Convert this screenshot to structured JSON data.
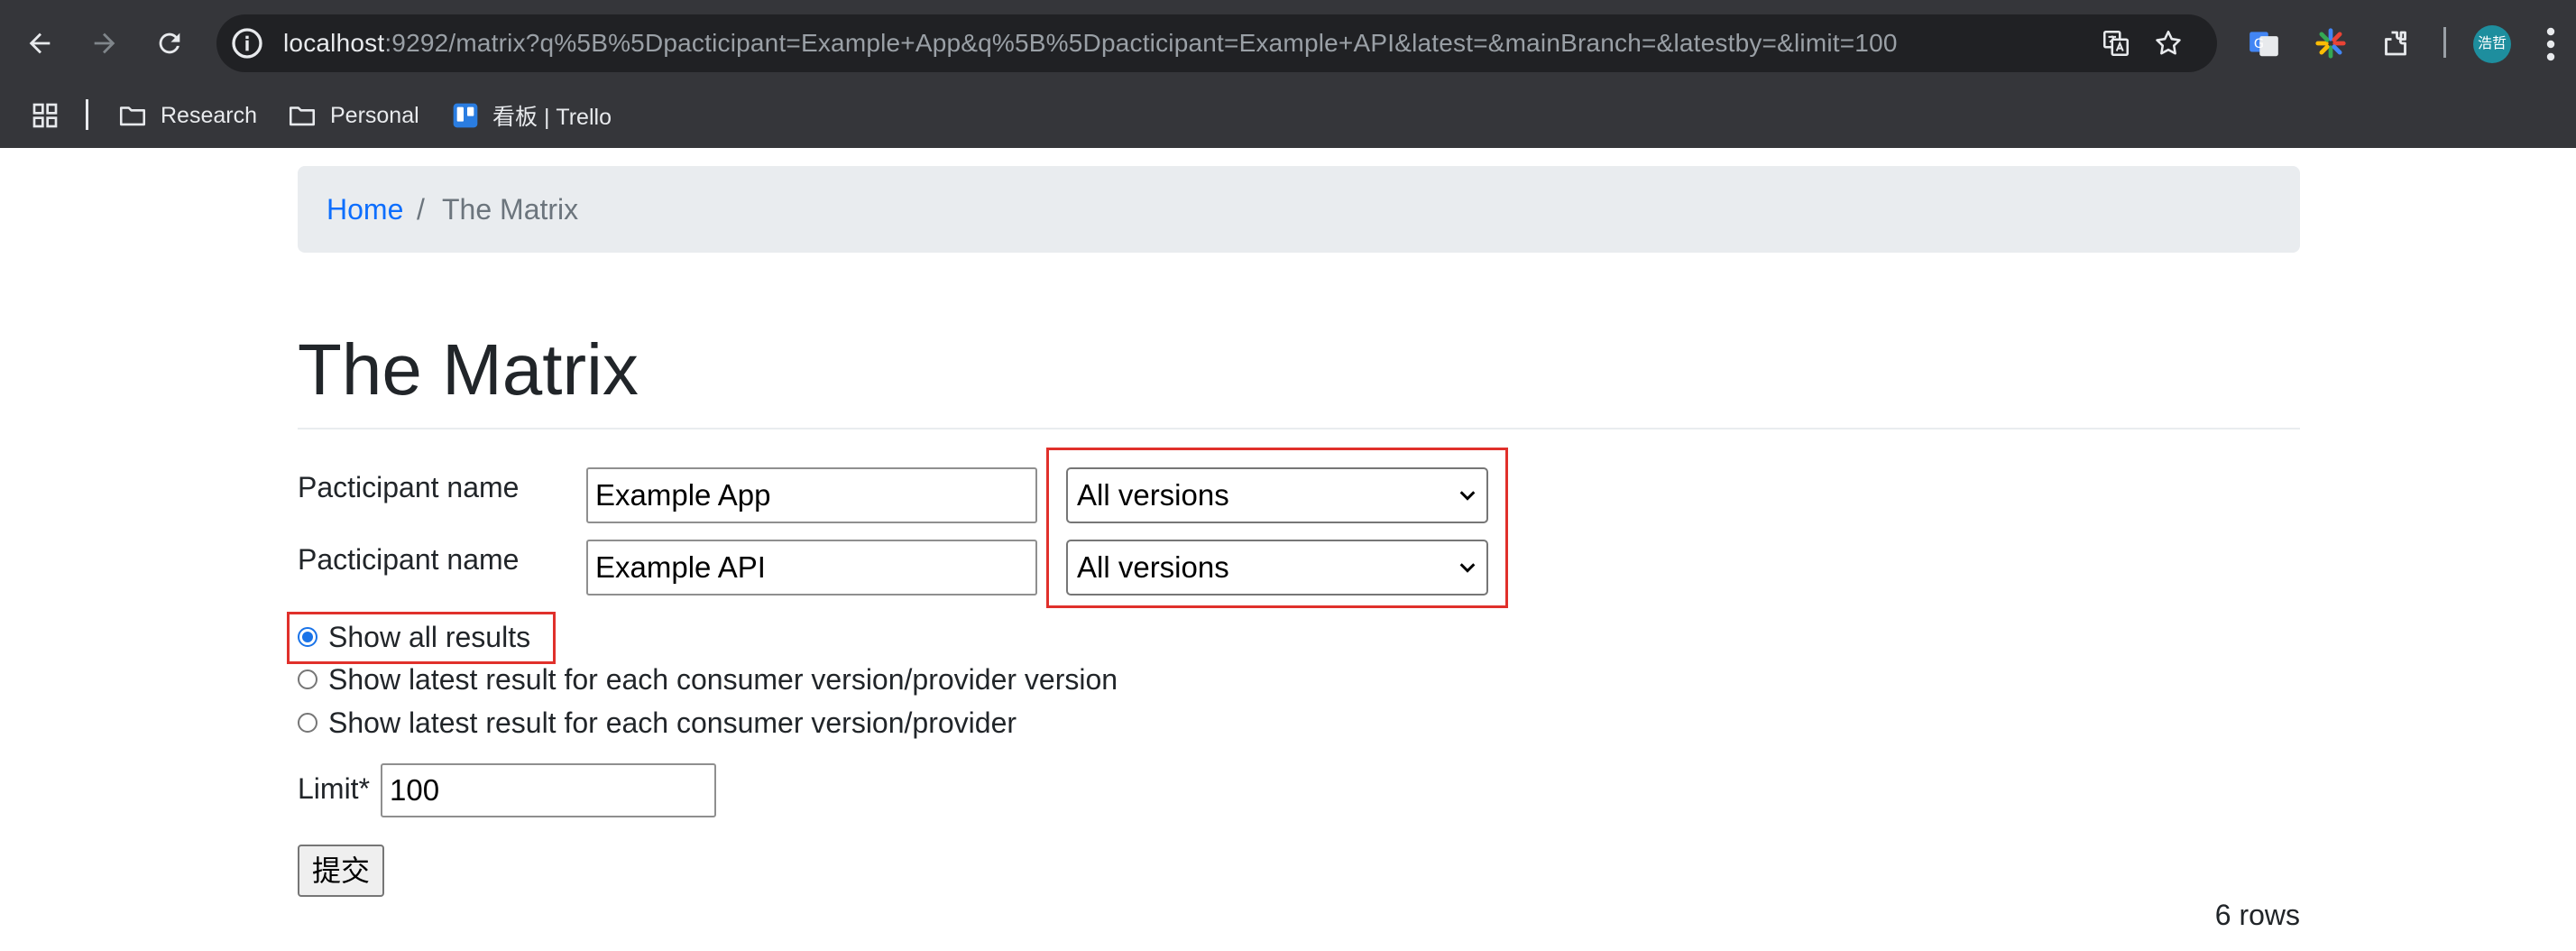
{
  "browser": {
    "url_host": "localhost",
    "url_rest": ":9292/matrix?q%5B%5Dpacticipant=Example+App&q%5B%5Dpacticipant=Example+API&latest=&mainBranch=&latestby=&limit=100",
    "avatar_text": "浩哲",
    "bookmarks": [
      {
        "label": "Research",
        "icon": "folder-icon"
      },
      {
        "label": "Personal",
        "icon": "folder-icon"
      },
      {
        "label": "看板 | Trello",
        "icon": "trello-icon"
      }
    ],
    "colors": {
      "chrome": "#35363a",
      "omnibox": "#202124",
      "avatar": "#1e8e9e"
    }
  },
  "breadcrumb": {
    "home": "Home",
    "separator": "/",
    "current": "The Matrix"
  },
  "page": {
    "title": "The Matrix"
  },
  "form": {
    "participants": [
      {
        "label": "Pacticipant name",
        "value": "Example App",
        "version_select": "All versions"
      },
      {
        "label": "Pacticipant name",
        "value": "Example API",
        "version_select": "All versions"
      }
    ],
    "radio_options": [
      {
        "label": "Show all results",
        "checked": true
      },
      {
        "label": "Show latest result for each consumer version/provider version",
        "checked": false
      },
      {
        "label": "Show latest result for each consumer version/provider",
        "checked": false
      }
    ],
    "limit_label": "Limit*",
    "limit_value": "100",
    "submit_label": "提交"
  },
  "result_count": "6 rows",
  "highlight_color": "#e0302b"
}
